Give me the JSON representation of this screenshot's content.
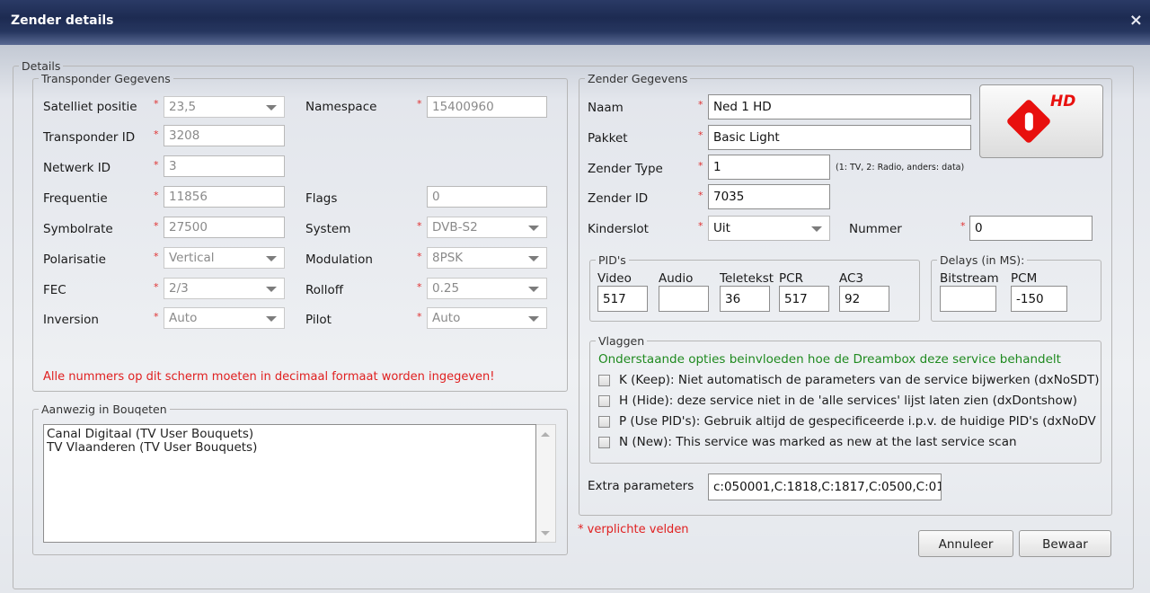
{
  "window": {
    "title": "Zender details",
    "close_glyph": "×"
  },
  "details_legend": "Details",
  "transponder": {
    "legend": "Transponder Gegevens",
    "satelliet_label": "Satelliet positie",
    "satelliet_value": "23,5",
    "transponder_id_label": "Transponder ID",
    "transponder_id_value": "3208",
    "netwerk_id_label": "Netwerk ID",
    "netwerk_id_value": "3",
    "frequentie_label": "Frequentie",
    "frequentie_value": "11856",
    "symbolrate_label": "Symbolrate",
    "symbolrate_value": "27500",
    "polarisatie_label": "Polarisatie",
    "polarisatie_value": "Vertical",
    "fec_label": "FEC",
    "fec_value": "2/3",
    "inversion_label": "Inversion",
    "inversion_value": "Auto",
    "namespace_label": "Namespace",
    "namespace_value": "15400960",
    "flags_label": "Flags",
    "flags_value": "0",
    "system_label": "System",
    "system_value": "DVB-S2",
    "modulation_label": "Modulation",
    "modulation_value": "8PSK",
    "rolloff_label": "Rolloff",
    "rolloff_value": "0.25",
    "pilot_label": "Pilot",
    "pilot_value": "Auto",
    "warning": "Alle nummers op dit scherm moeten in decimaal formaat worden ingegeven!",
    "warning_color": "#e02020"
  },
  "bouquets": {
    "legend": "Aanwezig in Bouqeten",
    "items": [
      "Canal Digitaal (TV User Bouquets)",
      "TV Vlaanderen (TV User Bouquets)"
    ]
  },
  "zender": {
    "legend": "Zender Gegevens",
    "naam_label": "Naam",
    "naam_value": "Ned 1 HD",
    "pakket_label": "Pakket",
    "pakket_value": "Basic Light",
    "type_label": "Zender Type",
    "type_value": "1",
    "type_hint": "(1: TV, 2: Radio, anders: data)",
    "id_label": "Zender ID",
    "id_value": "7035",
    "kinderslot_label": "Kinderslot",
    "kinderslot_value": "Uit",
    "nummer_label": "Nummer",
    "nummer_value": "0",
    "logo_text": "HD",
    "logo_color": "#e8100e"
  },
  "pids": {
    "legend": "PID's",
    "video_label": "Video",
    "video_value": "517",
    "audio_label": "Audio",
    "audio_value": "",
    "teletekst_label": "Teletekst",
    "teletekst_value": "36",
    "pcr_label": "PCR",
    "pcr_value": "517",
    "ac3_label": "AC3",
    "ac3_value": "92"
  },
  "delays": {
    "legend": "Delays (in MS):",
    "bitstream_label": "Bitstream",
    "bitstream_value": "",
    "pcm_label": "PCM",
    "pcm_value": "-150"
  },
  "vlaggen": {
    "legend": "Vlaggen",
    "info": "Onderstaande opties beinvloeden hoe de Dreambox deze service behandelt",
    "info_color": "#1f8a1f",
    "flags": [
      "K (Keep): Niet automatisch de parameters van de service bijwerken (dxNoSDT)",
      "H (Hide): deze service niet in de 'alle services' lijst laten zien (dxDontshow)",
      "P (Use PID's): Gebruik altijd de gespecificeerde i.p.v. de huidige PID's (dxNoDV",
      "N (New): This service was marked as new at the last service scan"
    ]
  },
  "extra": {
    "label": "Extra parameters",
    "value": "c:050001,C:1818,C:1817,C:0500,C:01"
  },
  "required_note": "* verplichte velden",
  "required_star": "*",
  "buttons": {
    "cancel": "Annuleer",
    "save": "Bewaar"
  }
}
